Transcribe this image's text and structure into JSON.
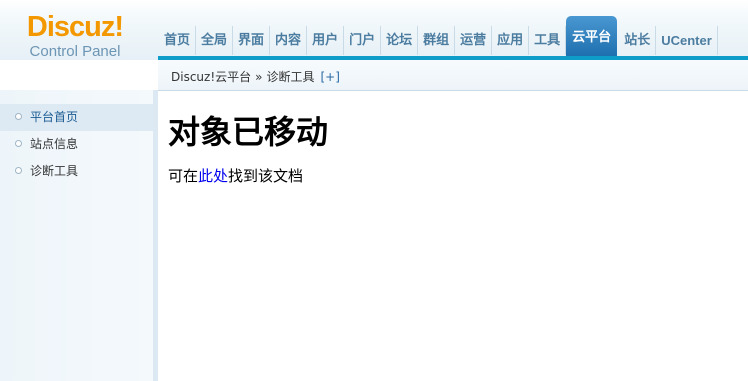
{
  "logo": {
    "title": "Discuz!",
    "subtitle": "Control Panel"
  },
  "nav": {
    "items": [
      {
        "label": "首页"
      },
      {
        "label": "全局"
      },
      {
        "label": "界面"
      },
      {
        "label": "内容"
      },
      {
        "label": "用户"
      },
      {
        "label": "门户"
      },
      {
        "label": "论坛"
      },
      {
        "label": "群组"
      },
      {
        "label": "运营"
      },
      {
        "label": "应用"
      },
      {
        "label": "工具"
      },
      {
        "label": "云平台",
        "active": true
      },
      {
        "label": "站长"
      },
      {
        "label": "UCenter"
      }
    ]
  },
  "breadcrumb": {
    "root": "Discuz!云平台",
    "separator": "»",
    "current": "诊断工具",
    "add": "[+]"
  },
  "sidebar": {
    "items": [
      {
        "label": "平台首页",
        "active": true
      },
      {
        "label": "站点信息"
      },
      {
        "label": "诊断工具"
      }
    ]
  },
  "content": {
    "heading": "对象已移动",
    "message_before": "可在",
    "link_text": "此处",
    "message_after": "找到该文档"
  },
  "colors": {
    "logo_orange": "#f39800",
    "nav_active": "#1e70ae",
    "nav_text": "#4c7da0",
    "nav_bar": "#0e9cc9",
    "link": "#0000ee"
  }
}
